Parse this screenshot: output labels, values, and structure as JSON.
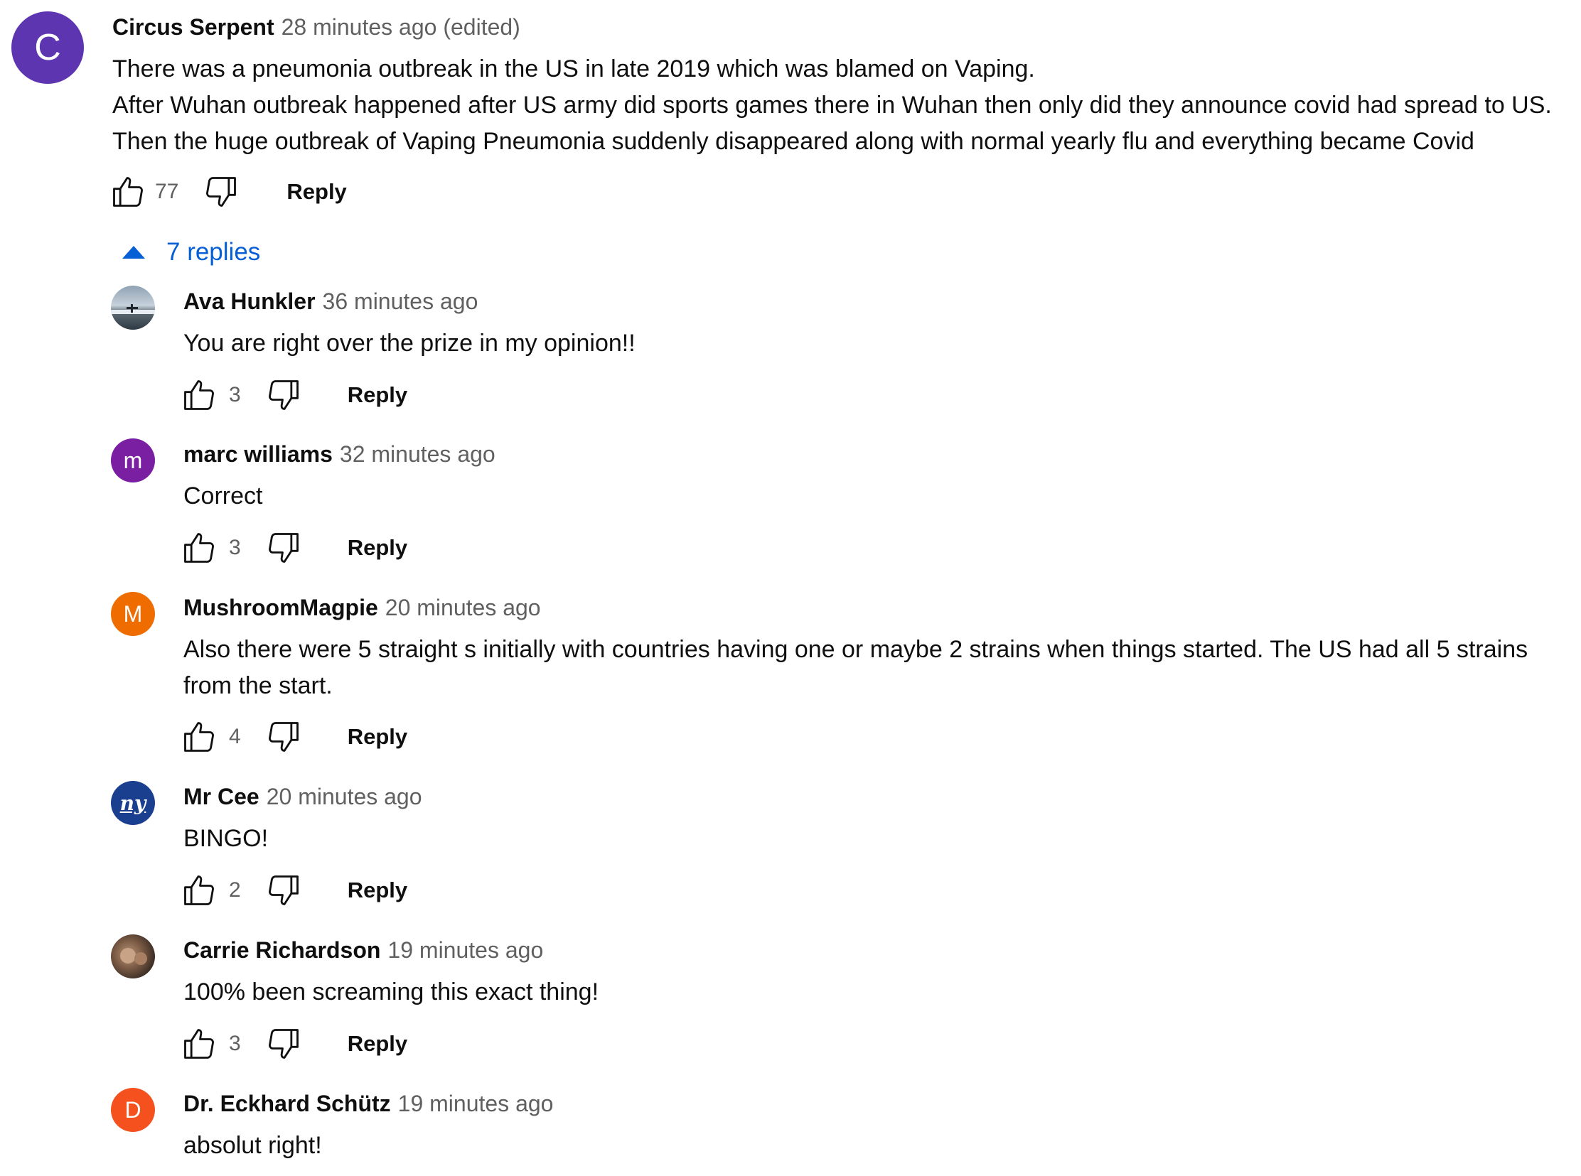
{
  "main_comment": {
    "avatar_letter": "C",
    "avatar_color": "#5e35b1",
    "author": "Circus Serpent",
    "time": "28 minutes ago (edited)",
    "lines": [
      "There was a pneumonia outbreak in the US in late 2019 which was blamed on Vaping.",
      "After Wuhan outbreak happened after US army did sports games there in Wuhan then only did they announce covid had spread to US.",
      "Then the huge outbreak of Vaping Pneumonia suddenly disappeared along with normal yearly flu and everything became Covid"
    ],
    "likes": "77",
    "reply_label": "Reply"
  },
  "replies_toggle": {
    "label": "7 replies",
    "icon": "caret-up-icon"
  },
  "replies": [
    {
      "author": "Ava Hunkler",
      "time": "36 minutes ago",
      "avatar_type": "photo-landscape",
      "lines": [
        "You are right over the prize in my opinion!!"
      ],
      "likes": "3",
      "reply_label": "Reply"
    },
    {
      "author": "marc williams",
      "time": "32 minutes ago",
      "avatar_letter": "m",
      "avatar_color": "#7b1fa2",
      "lines": [
        "Correct"
      ],
      "likes": "3",
      "reply_label": "Reply"
    },
    {
      "author": "MushroomMagpie",
      "time": "20 minutes ago",
      "avatar_letter": "M",
      "avatar_color": "#ef6c00",
      "lines": [
        "Also there were 5 straight s initially with countries having one or maybe 2 strains when things started. The US had all 5 strains",
        "from the start."
      ],
      "likes": "4",
      "reply_label": "Reply"
    },
    {
      "author": "Mr Cee",
      "time": "20 minutes ago",
      "avatar_type": "logo-ny",
      "avatar_logo_text": "ny",
      "lines": [
        "BINGO!"
      ],
      "likes": "2",
      "reply_label": "Reply"
    },
    {
      "author": "Carrie Richardson",
      "time": "19 minutes ago",
      "avatar_type": "photo-people",
      "lines": [
        "100% been screaming this exact thing!"
      ],
      "likes": "3",
      "reply_label": "Reply"
    },
    {
      "author": "Dr. Eckhard Schütz",
      "time": "19 minutes ago",
      "avatar_letter": "D",
      "avatar_color": "#f4511e",
      "lines": [
        "absolut right!"
      ]
    }
  ],
  "colors": {
    "link_blue": "#065fd4",
    "meta_gray": "#606060",
    "text": "#0f0f0f"
  }
}
